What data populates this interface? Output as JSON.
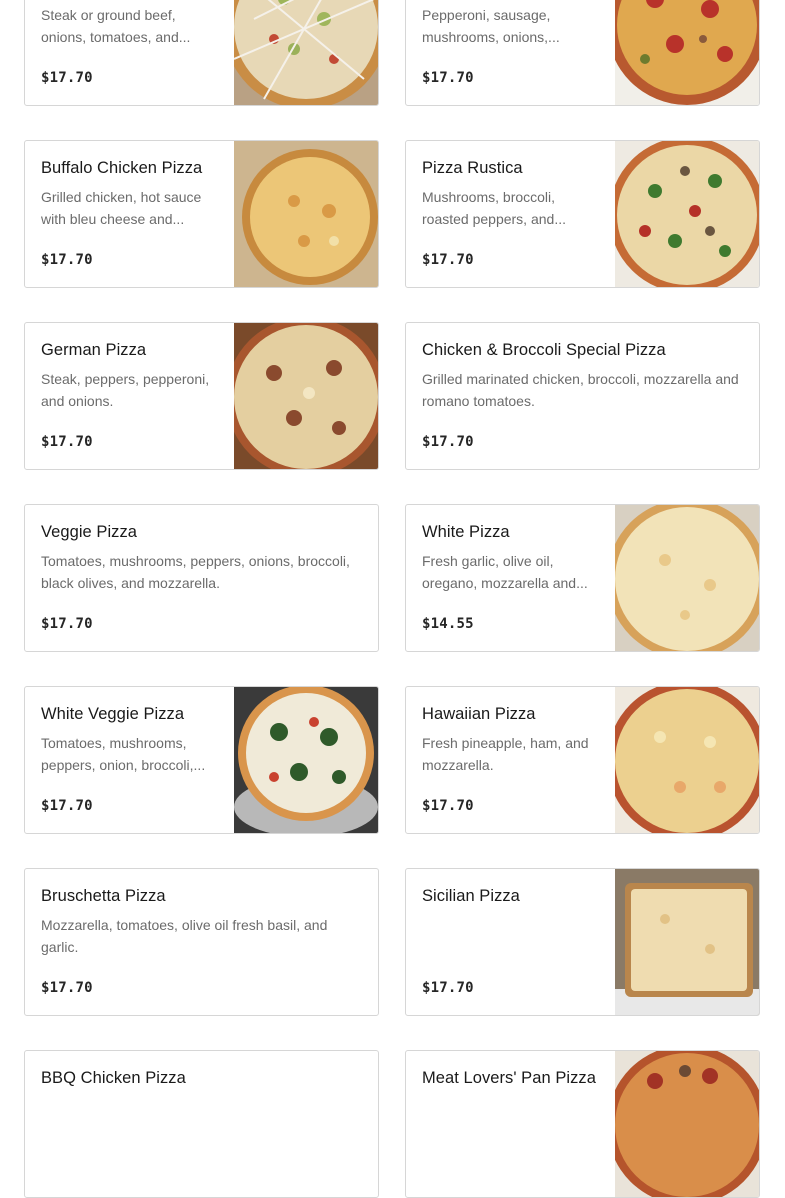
{
  "menu": {
    "items": [
      {
        "name": "",
        "description": "Steak or ground beef, onions, tomatoes, and...",
        "price": "$17.70",
        "image": "pizza-photo-drizzle",
        "has_image": true
      },
      {
        "name": "",
        "description": "Pepperoni, sausage, mushrooms, onions,...",
        "price": "$17.70",
        "image": "pizza-photo-pepperoni",
        "has_image": true
      },
      {
        "name": "Buffalo Chicken Pizza",
        "description": "Grilled chicken, hot sauce with bleu cheese and...",
        "price": "$17.70",
        "image": "pizza-photo-buffalo",
        "has_image": true
      },
      {
        "name": "Pizza Rustica",
        "description": "Mushrooms, broccoli, roasted peppers, and...",
        "price": "$17.70",
        "image": "pizza-photo-rustica",
        "has_image": true
      },
      {
        "name": "German Pizza",
        "description": "Steak, peppers, pepperoni, and onions.",
        "price": "$17.70",
        "image": "pizza-photo-german",
        "has_image": true
      },
      {
        "name": "Chicken & Broccoli Special Pizza",
        "description": "Grilled marinated chicken, broccoli, mozzarella and romano tomatoes.",
        "price": "$17.70",
        "has_image": false
      },
      {
        "name": "Veggie Pizza",
        "description": "Tomatoes, mushrooms, peppers, onions, broccoli, black olives, and mozzarella.",
        "price": "$17.70",
        "has_image": false
      },
      {
        "name": "White Pizza",
        "description": "Fresh garlic, olive oil, oregano, mozzarella and...",
        "price": "$14.55",
        "image": "pizza-photo-white",
        "has_image": true
      },
      {
        "name": "White Veggie Pizza",
        "description": "Tomatoes, mushrooms, peppers, onion, broccoli,...",
        "price": "$17.70",
        "image": "pizza-photo-white-veggie",
        "has_image": true
      },
      {
        "name": "Hawaiian Pizza",
        "description": "Fresh pineapple, ham, and mozzarella.",
        "price": "$17.70",
        "image": "pizza-photo-hawaiian",
        "has_image": true
      },
      {
        "name": "Bruschetta Pizza",
        "description": "Mozzarella, tomatoes, olive oil fresh basil, and garlic.",
        "price": "$17.70",
        "has_image": false
      },
      {
        "name": "Sicilian Pizza",
        "description": "",
        "price": "$17.70",
        "image": "pizza-photo-sicilian",
        "has_image": true
      },
      {
        "name": "BBQ Chicken Pizza",
        "description": "",
        "price": "",
        "has_image": false
      },
      {
        "name": "Meat Lovers' Pan Pizza",
        "description": "",
        "price": "",
        "image": "pizza-photo-meat-lovers",
        "has_image": true
      }
    ]
  },
  "colors": {
    "card_border": "#d6d6d6",
    "title": "#1a1a1a",
    "description": "#6b6b6b",
    "price": "#262626"
  }
}
